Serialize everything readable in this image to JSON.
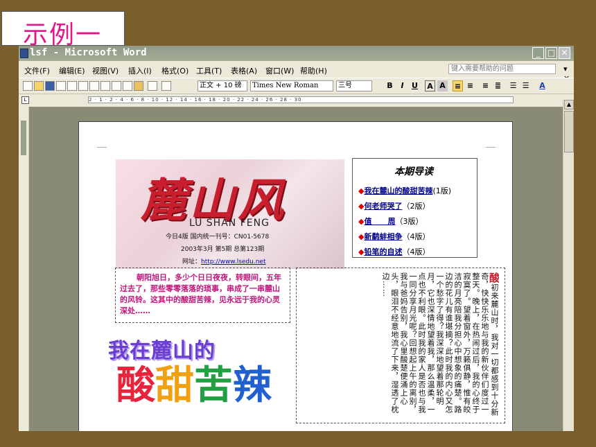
{
  "label": "示例一",
  "window": {
    "title": "lsf - Microsoft Word"
  },
  "menu": [
    "文件(F)",
    "编辑(E)",
    "视图(V)",
    "插入(I)",
    "格式(O)",
    "工具(T)",
    "表格(A)",
    "窗口(W)",
    "帮助(H)"
  ],
  "help_placeholder": "键入需要帮助的问题",
  "toolbar": {
    "style": "正文 + 10 磅",
    "font": "Times New Roman",
    "size": "三号"
  },
  "ruler_text": "2 · 1 · 2 · 4 · 6 · 8 · 10 · 12 · 14 · 16 · 18 · 20 · 22 · 24 · 26 · 28 · 30",
  "banner": {
    "title": "麓山风",
    "en": "LU SHAN FENG",
    "line1": "今日4版      国内统一刊号：CN01-5678",
    "line2": "2003年3月  第5期  总第123期",
    "site_label": "网址：",
    "site_url": "http://www.lsedu.net"
  },
  "guide": {
    "title": "本期导读",
    "items": [
      {
        "link": "我在麓山的酸甜苦辣",
        "suffix": "(1版)"
      },
      {
        "link": "何老师哭了",
        "suffix": "（2版）"
      },
      {
        "link": "值      周",
        "suffix": "（3版）"
      },
      {
        "link": "新鹬蚌相争",
        "suffix": "（4版）"
      },
      {
        "link": "铅笔的自述",
        "suffix": "（4版）"
      }
    ]
  },
  "intro": "朝阳旭日，多少个日日夜夜，转眼间，五年过去了，那些零零落落的琐事，串成了一串麓山的风铃。这其中的酸甜苦辣，见永远于我的心灵深处……",
  "art_title1": "我在麓山的",
  "art_title2": [
    "酸",
    "甜",
    "苦",
    "辣"
  ],
  "article_big": "酸",
  "article": "初来麓山时，我对一切都感到十分新奇，快快乐乐地与我的新伙伴们度过一整天。晚上，在热闹过后，我的心终于寂寞了。望着窗外，万籁俱静，惟有皎洁的月亮陪我分担心中想象的痛楚。路边的花儿有谁堪摘？此时我的内心又怎一个愁字了得？我深深地望着那轮明月，它也深情地望着我，那么温柔，一点也不利眼。此时我的家人是否也与我一同分享月光呢？回想起上午的离别，我与爸妈告别，我心里酸楚便涌上心头，眼泪不经意地流了下来，湿透了枕边……"
}
